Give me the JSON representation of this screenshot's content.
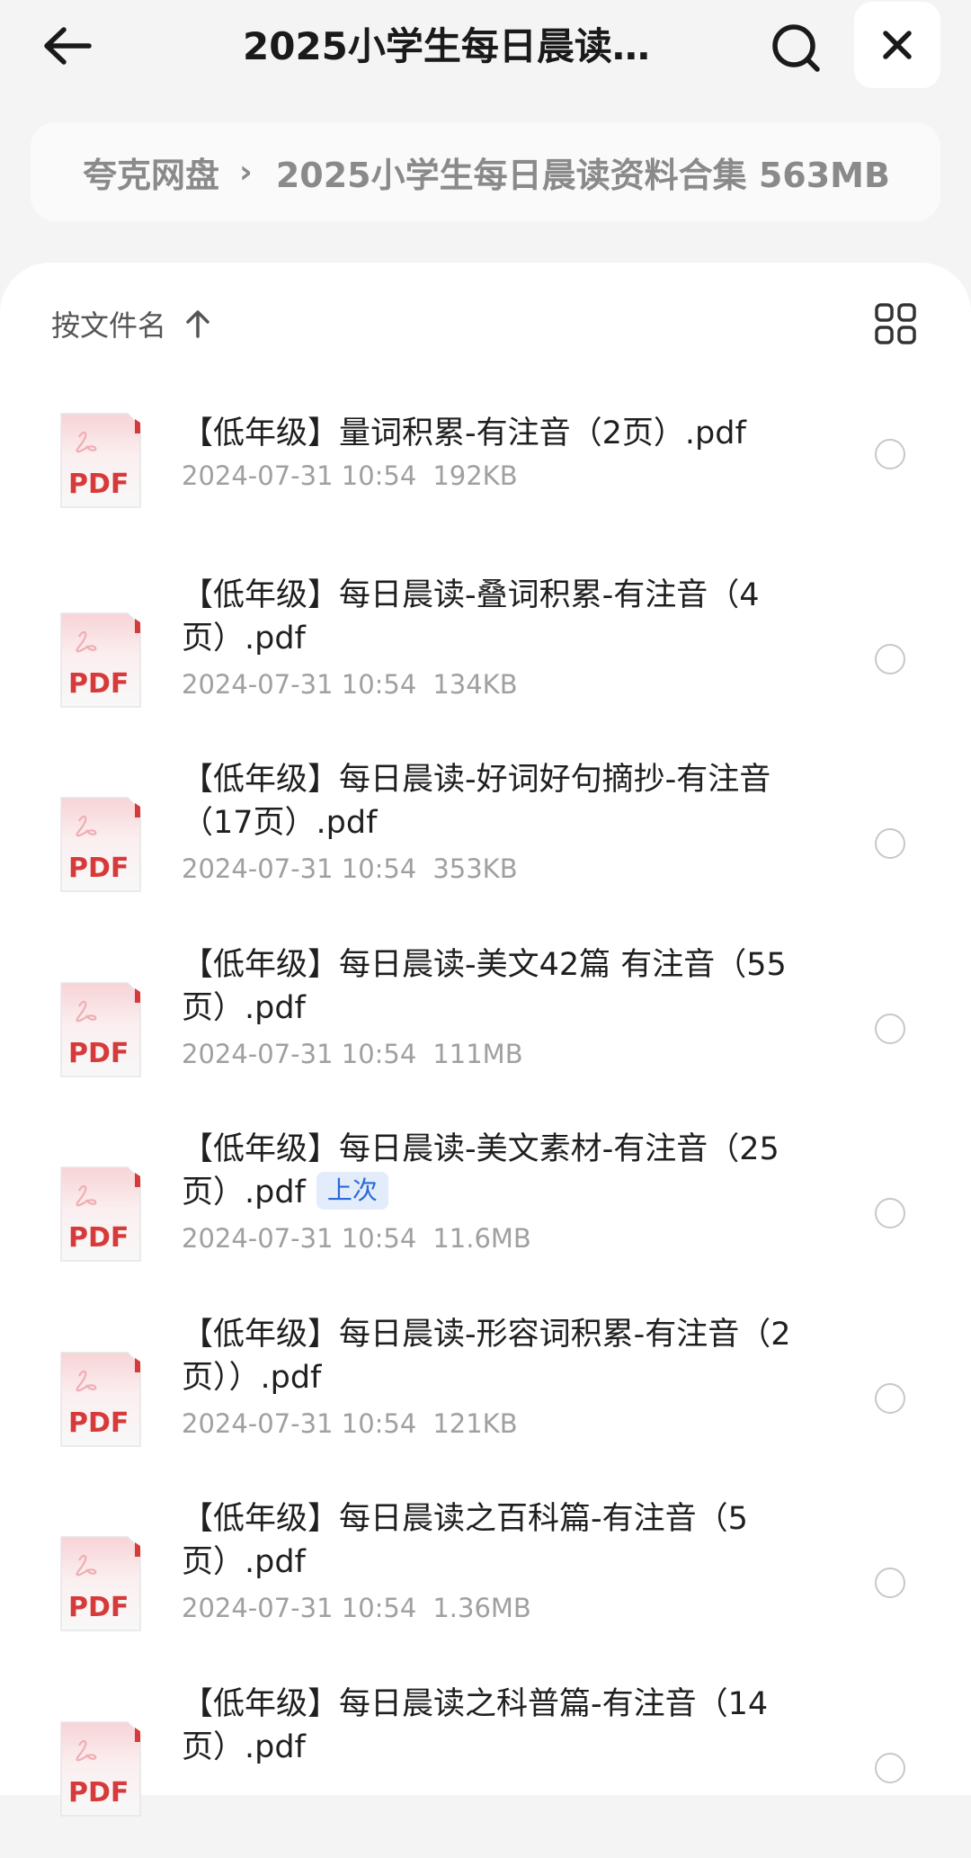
{
  "header": {
    "title": "2025小学生每日晨读…"
  },
  "breadcrumb": {
    "root": "夸克网盘",
    "separator": "›",
    "current": "2025小学生每日晨读资料合集 563MB"
  },
  "sort": {
    "label": "按文件名"
  },
  "files": [
    {
      "name": "【低年级】量词积累-有注音（2页）.pdf",
      "date": "2024-07-31 10:54",
      "size": "192KB"
    },
    {
      "name": "【低年级】每日晨读-叠词积累-有注音（4页）.pdf",
      "date": "2024-07-31 10:54",
      "size": "134KB"
    },
    {
      "name": "【低年级】每日晨读-好词好句摘抄-有注音（17页）.pdf",
      "date": "2024-07-31 10:54",
      "size": "353KB"
    },
    {
      "name": "【低年级】每日晨读-美文42篇 有注音（55页）.pdf",
      "date": "2024-07-31 10:54",
      "size": "111MB"
    },
    {
      "name": "【低年级】每日晨读-美文素材-有注音（25页）.pdf",
      "date": "2024-07-31 10:54",
      "size": "11.6MB",
      "badge": "上次"
    },
    {
      "name": "【低年级】每日晨读-形容词积累-有注音（2页））.pdf",
      "date": "2024-07-31 10:54",
      "size": "121KB"
    },
    {
      "name": "【低年级】每日晨读之百科篇-有注音（5页）.pdf",
      "date": "2024-07-31 10:54",
      "size": "1.36MB"
    },
    {
      "name": "【低年级】每日晨读之科普篇-有注音（14页）.pdf",
      "date": "",
      "size": ""
    }
  ],
  "icons": {
    "back": "arrow-left-icon",
    "search": "search-icon",
    "close": "close-icon",
    "sort_direction": "arrow-up-icon",
    "view_toggle": "grid-view-icon",
    "file_type": "pdf-icon",
    "file_type_label": "PDF"
  },
  "colors": {
    "pdf_red": "#d63a3a",
    "badge_blue": "#2a6ad8",
    "badge_bg": "#e3ecfb"
  }
}
